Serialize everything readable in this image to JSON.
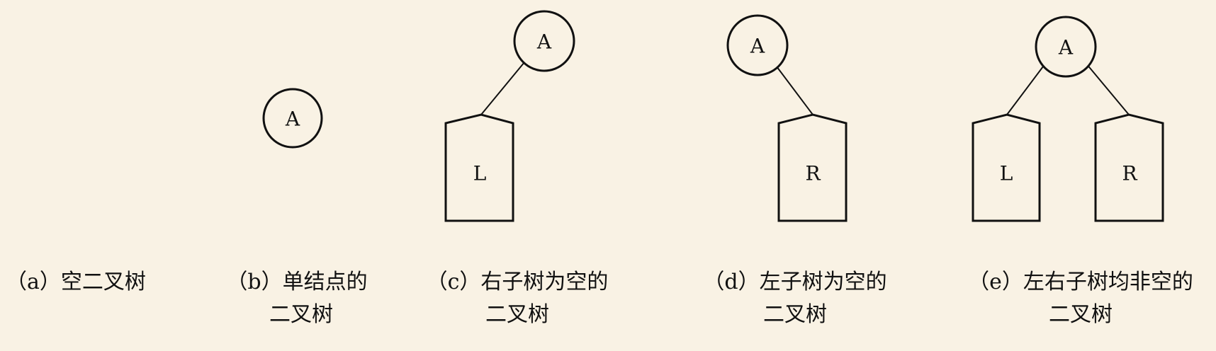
{
  "trees": {
    "b": {
      "root": "A"
    },
    "c": {
      "root": "A",
      "left": "L"
    },
    "d": {
      "root": "A",
      "right": "R"
    },
    "e": {
      "root": "A",
      "left": "L",
      "right": "R"
    }
  },
  "captions": {
    "a": {
      "line1": "（a）空二叉树"
    },
    "b": {
      "line1": "（b）单结点的",
      "line2": "二叉树"
    },
    "c": {
      "line1": "（c）右子树为空的",
      "line2": "二叉树"
    },
    "d": {
      "line1": "（d）左子树为空的",
      "line2": "二叉树"
    },
    "e": {
      "line1": "（e）左右子树均非空的",
      "line2": "二叉树"
    }
  }
}
